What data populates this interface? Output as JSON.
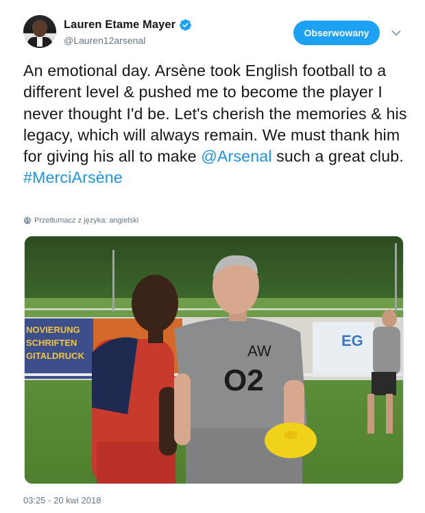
{
  "user": {
    "display_name": "Lauren Etame Mayer",
    "handle": "@Lauren12arsenal",
    "verified": true
  },
  "follow_button": {
    "label": "Obserwowany"
  },
  "tweet": {
    "text_parts": [
      {
        "type": "text",
        "value": "An emotional day. Arsène took English football to a different level & pushed me to become the player I never thought I'd be. Let's cherish the memories & his legacy, which will always remain. We must thank him for giving his all to make "
      },
      {
        "type": "mention",
        "value": "@Arsenal"
      },
      {
        "type": "text",
        "value": " such a great club. "
      },
      {
        "type": "hashtag",
        "value": "#MerciArsène"
      }
    ],
    "translate_label": "Przetłumacz z języka: angielski",
    "timestamp": "03:25 - 20 kwi 2018"
  },
  "photo": {
    "banner_lines": [
      "NOVIERUNG",
      "SCHRIFTEN",
      "GITALDRUCK"
    ],
    "shirt_initials": "AW",
    "shirt_sponsor": "O2",
    "banner_right": "EG"
  },
  "colors": {
    "accent": "#1da1f2",
    "link": "#1b95e0",
    "muted": "#657786"
  },
  "icons": [
    "verified-badge-icon",
    "chevron-down-icon",
    "globe-icon"
  ]
}
